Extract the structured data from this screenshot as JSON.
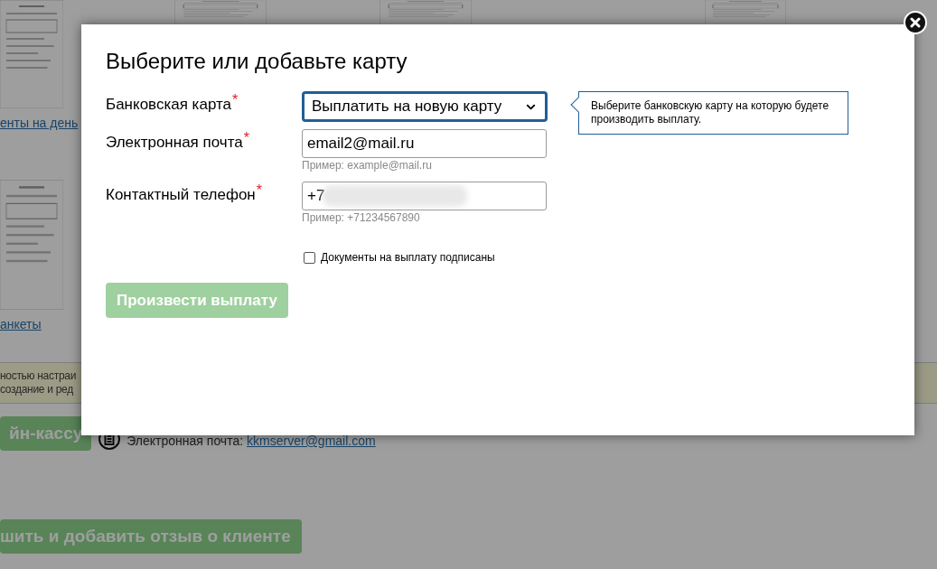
{
  "background": {
    "links": [
      "енты на день",
      "анкеты"
    ],
    "banner": {
      "lines": [
        "ностью настраи",
        "создание и ред"
      ]
    },
    "cashbox_button": "йн-кассу",
    "support": {
      "email_label": "Электронная почта:",
      "email": "kkmserver@gmail.com"
    },
    "review_button": "шить и добавить отзыв о клиенте"
  },
  "dialog": {
    "title": "Выберите или добавьте карту",
    "fields": [
      {
        "kind": "select",
        "label": "Банковская карта",
        "required_mark": "*",
        "value": "Выплатить на новую карту",
        "focused": true
      },
      {
        "kind": "text",
        "label": "Электронная почта",
        "required_mark": "*",
        "value": "email2@mail.ru",
        "hint": "Пример: example@mail.ru",
        "focused": false
      },
      {
        "kind": "text",
        "label": "Контактный телефон",
        "required_mark": "*",
        "value": "+7",
        "redacted": true,
        "hint": "Пример: +71234567890",
        "focused": false
      }
    ],
    "tooltip": "Выберите банковскую карту на которую будете производить выплату.",
    "checkbox": {
      "label": "Документы на выплату подписаны",
      "checked": false
    },
    "submit": {
      "label": "Произвести выплату",
      "disabled": true
    }
  }
}
